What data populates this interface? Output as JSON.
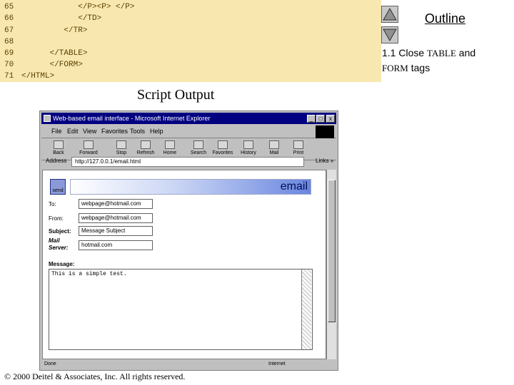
{
  "code": {
    "lines": [
      {
        "num": "65",
        "text": "            </P><P> </P>"
      },
      {
        "num": "66",
        "text": "            </TD>"
      },
      {
        "num": "67",
        "text": "         </TR>"
      },
      {
        "num": "68",
        "text": ""
      },
      {
        "num": "69",
        "text": "      </TABLE>"
      },
      {
        "num": "70",
        "text": "      </FORM>"
      },
      {
        "num": "71",
        "text": "</HTML>"
      }
    ]
  },
  "outline": {
    "title": "Outline",
    "item_prefix": "1.1 Close ",
    "item_table": "TABLE",
    "item_and": " and",
    "item_form": "FORM",
    "item_tags": " tags"
  },
  "script_output_title": "Script Output",
  "browser": {
    "title": "Web-based email interface - Microsoft Internet Explorer",
    "minimize": "_",
    "maximize": "□",
    "close": "x",
    "menus": [
      "File",
      "Edit",
      "View",
      "Favorites",
      "Tools",
      "Help"
    ],
    "toolbar": [
      "Back",
      "Forward",
      "Stop",
      "Refresh",
      "Home",
      "Search",
      "Favorites",
      "History",
      "Mail",
      "Print"
    ],
    "address_label": "Address",
    "address_value": "http://127.0.0.1/email.html",
    "links_label": "Links »",
    "status_left": "Done",
    "status_right": "Internet"
  },
  "page": {
    "send_label": "send",
    "header": "email",
    "to_label": "To:",
    "to_value": "webpage@hotmail.com",
    "from_label": "From:",
    "from_value": "webpage@hotmail.com",
    "subject_label": "Subject:",
    "subject_value": "Message Subject",
    "server_label_1": "Mail",
    "server_label_2": "Server:",
    "server_value": "hotmail.com",
    "message_label": "Message:",
    "message_value": "This is a simple test."
  },
  "footer": {
    "copyright": "© 2000 Deitel & Associates, Inc.  All rights reserved."
  }
}
